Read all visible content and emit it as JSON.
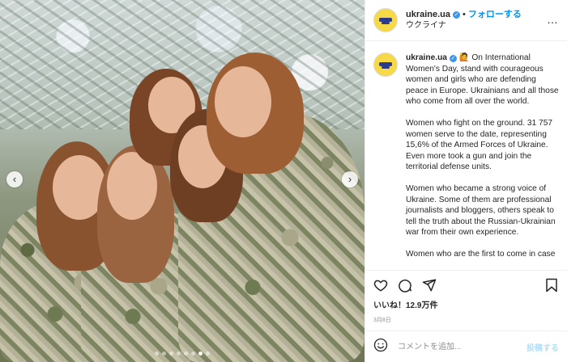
{
  "header": {
    "username": "ukraine.ua",
    "separator": "•",
    "follow_label": "フォローする",
    "location": "ウクライナ",
    "more": "…"
  },
  "caption": {
    "username": "ukraine.ua",
    "emoji": "🙋",
    "paragraphs": [
      "On International Women's Day, stand with courageous women and girls who are defending peace in Europe. Ukrainians and all those who come from all over the world.",
      "Women who fight on the ground. 31 757 women serve to the date, representing 15,6% of the Armed Forces of Ukraine. Even more took a gun and join the territorial defense units.",
      "Women who became a strong voice of Ukraine. Some of them are professional journalists and bloggers, others speak to tell the truth about the Russian-Ukrainian war from their own experience.",
      "Women who are the first to come in case"
    ]
  },
  "actions": {
    "like_icon": "heart-icon",
    "comment_icon": "comment-icon",
    "share_icon": "share-icon",
    "save_icon": "bookmark-icon"
  },
  "likes_text": "いいね！12.9万件",
  "date_text": "3月8日",
  "comment_box": {
    "emoji_icon": "smiley-icon",
    "placeholder": "コメントを追加...",
    "post_label": "投稿する"
  },
  "carousel": {
    "prev_icon": "chevron-left-icon",
    "next_icon": "chevron-right-icon",
    "dot_count": 8,
    "active_index": 6
  },
  "colors": {
    "link_blue": "#0095f6",
    "verified_blue": "#3897f0",
    "post_disabled": "#b2dffc",
    "muted": "#8e8e8e"
  }
}
